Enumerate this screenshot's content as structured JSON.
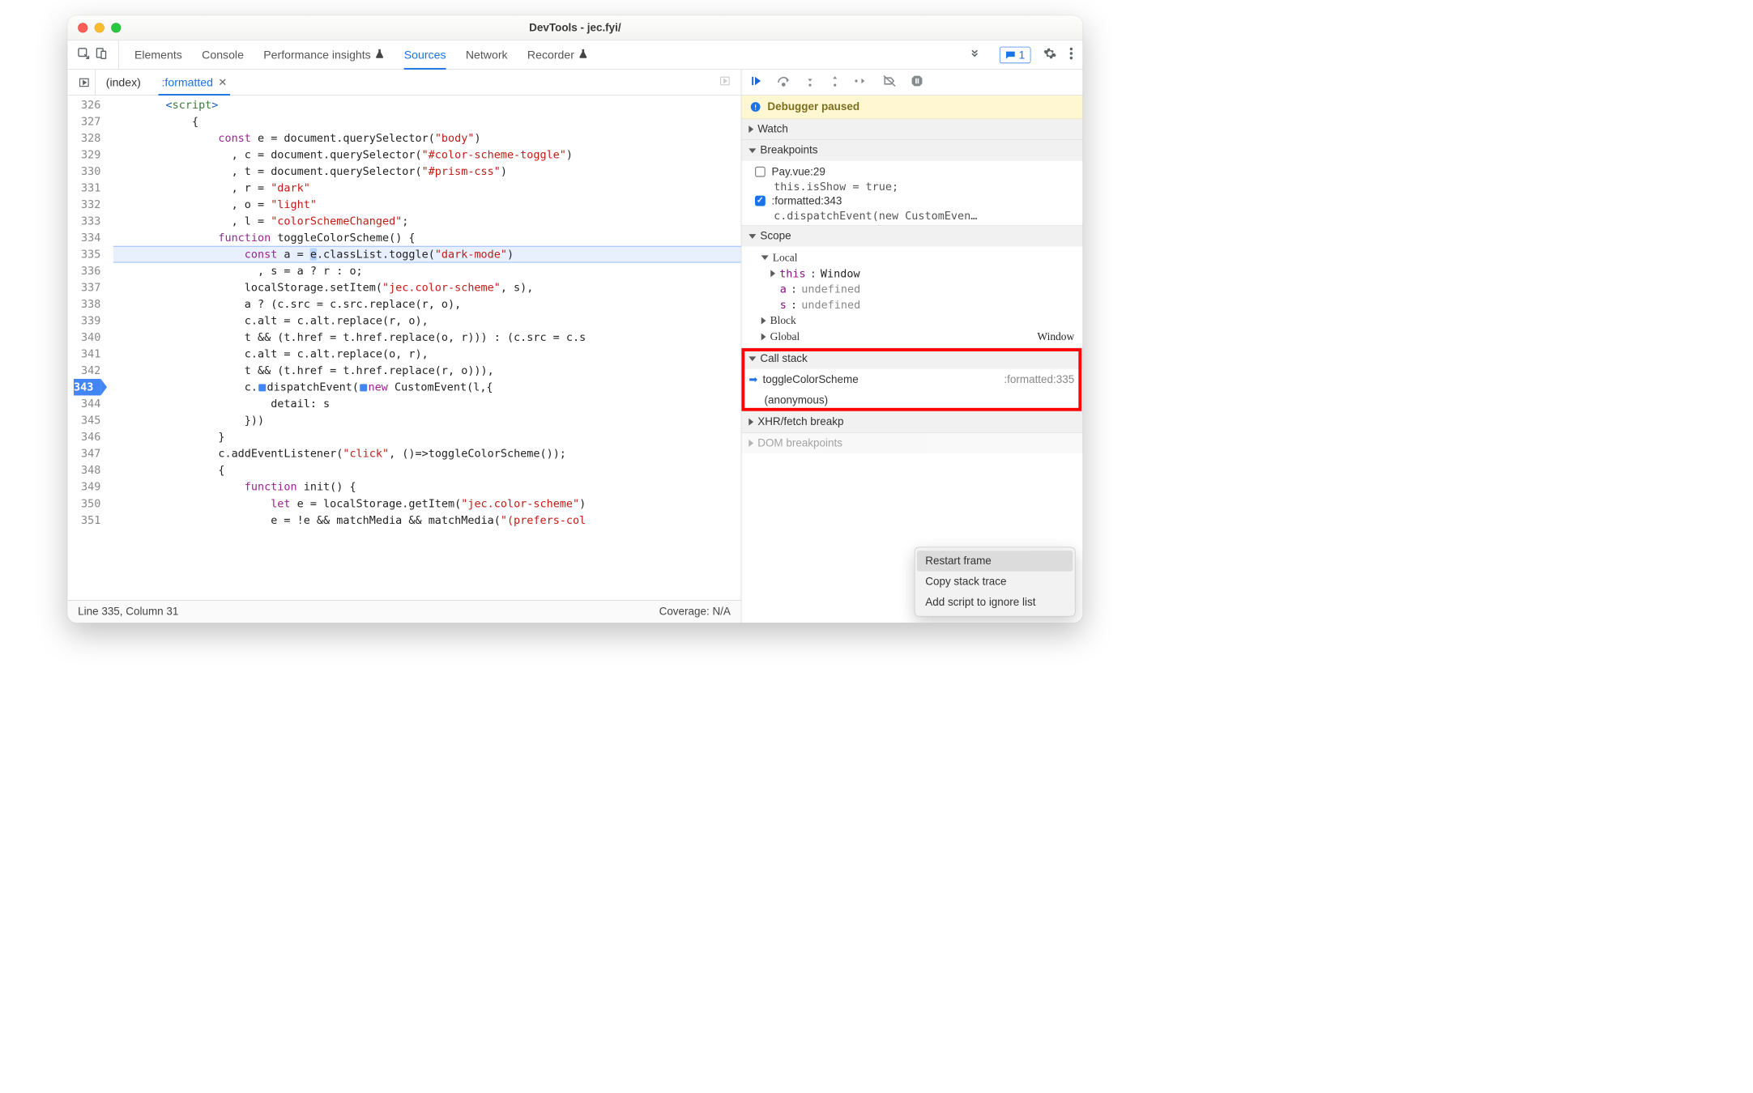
{
  "window_title": "DevTools - jec.fyi/",
  "panel_tabs": [
    "Elements",
    "Console",
    "Performance insights",
    "Sources",
    "Network",
    "Recorder"
  ],
  "active_panel_tab": "Sources",
  "messages_count": "1",
  "editor": {
    "file_tabs": [
      {
        "label": "(index)",
        "active": false,
        "closeable": false
      },
      {
        "label": ":formatted",
        "active": true,
        "closeable": true
      }
    ],
    "lines": [
      {
        "n": "326",
        "html": "        <span class='tag'>&lt;</span><span class='tagname'>script</span><span class='tag'>&gt;</span>"
      },
      {
        "n": "327",
        "html": "            {"
      },
      {
        "n": "328",
        "html": "                <span class='kw'>const</span> e = document.querySelector(<span class='str'>\"body\"</span>)"
      },
      {
        "n": "329",
        "html": "                  , c = document.querySelector(<span class='str'>\"#color-scheme-toggle\"</span>)"
      },
      {
        "n": "330",
        "html": "                  , t = document.querySelector(<span class='str'>\"#prism-css\"</span>)"
      },
      {
        "n": "331",
        "html": "                  , r = <span class='str'>\"dark\"</span>"
      },
      {
        "n": "332",
        "html": "                  , o = <span class='str'>\"light\"</span>"
      },
      {
        "n": "333",
        "html": "                  , l = <span class='str'>\"colorSchemeChanged\"</span>;"
      },
      {
        "n": "334",
        "html": "                <span class='kw'>function</span> toggleColorScheme() {"
      },
      {
        "n": "335",
        "exec": true,
        "html": "                    <span class='kw'>const</span> a = <span class='hl-var'>e</span>.classList.toggle(<span class='str'>\"dark-mode\"</span>)"
      },
      {
        "n": "336",
        "html": "                      , s = a ? r : o;"
      },
      {
        "n": "337",
        "html": "                    localStorage.setItem(<span class='str'>\"jec.color-scheme\"</span>, s),"
      },
      {
        "n": "338",
        "html": "                    a ? (c.src = c.src.replace(r, o),"
      },
      {
        "n": "339",
        "html": "                    c.alt = c.alt.replace(r, o),"
      },
      {
        "n": "340",
        "html": "                    t && (t.href = t.href.replace(o, r))) : (c.src = c.s"
      },
      {
        "n": "341",
        "html": "                    c.alt = c.alt.replace(o, r),"
      },
      {
        "n": "342",
        "html": "                    t && (t.href = t.href.replace(r, o))),"
      },
      {
        "n": "343",
        "bp": true,
        "html": "                    c.<span class='bp-marker'></span>dispatchEvent(<span class='bp-marker'></span><span class='kw'>new</span> CustomEvent(l,{"
      },
      {
        "n": "344",
        "html": "                        detail: s"
      },
      {
        "n": "345",
        "html": "                    }))"
      },
      {
        "n": "346",
        "html": "                }"
      },
      {
        "n": "347",
        "html": "                c.addEventListener(<span class='str'>\"click\"</span>, ()=&gt;toggleColorScheme());"
      },
      {
        "n": "348",
        "html": "                {"
      },
      {
        "n": "349",
        "html": "                    <span class='kw'>function</span> init() {"
      },
      {
        "n": "350",
        "html": "                        <span class='kw'>let</span> e = localStorage.getItem(<span class='str'>\"jec.color-scheme\"</span>)"
      },
      {
        "n": "351",
        "html": "                        e = !e && matchMedia && matchMedia(<span class='str'>\"(prefers-col</span>"
      }
    ],
    "status_left": "Line 335, Column 31",
    "status_right": "Coverage: N/A"
  },
  "debugger": {
    "paused_label": "Debugger paused",
    "sections": {
      "watch": "Watch",
      "breakpoints": "Breakpoints",
      "scope": "Scope",
      "callstack": "Call stack",
      "xhr": "XHR/fetch breakp",
      "dom": "DOM breakpoints"
    },
    "breakpoints": [
      {
        "checked": false,
        "label": "Pay.vue:29",
        "snippet": "this.isShow = true;"
      },
      {
        "checked": true,
        "label": ":formatted:343",
        "snippet": "c.dispatchEvent(new CustomEven…"
      }
    ],
    "scope": {
      "local_label": "Local",
      "this_label": "this",
      "this_value": "Window",
      "vars": [
        {
          "name": "a",
          "value": "undefined"
        },
        {
          "name": "s",
          "value": "undefined"
        }
      ],
      "block_label": "Block",
      "global_label": "Global",
      "global_value": "Window"
    },
    "callstack": [
      {
        "name": "toggleColorScheme",
        "loc": ":formatted:335",
        "current": true
      },
      {
        "name": "(anonymous)",
        "loc": "",
        "current": false
      }
    ],
    "context_menu": [
      "Restart frame",
      "Copy stack trace",
      "Add script to ignore list"
    ]
  }
}
